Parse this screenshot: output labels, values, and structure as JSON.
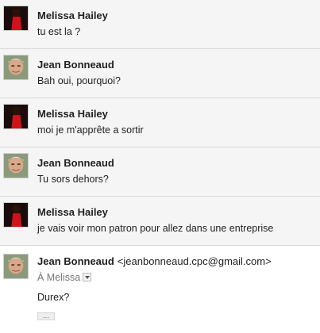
{
  "messages": [
    {
      "sender": "Melissa Hailey",
      "snippet": "tu est la ?",
      "avatar_icon": "woman-red-dress-avatar"
    },
    {
      "sender": "Jean Bonneaud",
      "snippet": "Bah oui, pourquoi?",
      "avatar_icon": "older-man-avatar"
    },
    {
      "sender": "Melissa Hailey",
      "snippet": "moi je m'apprête a sortir",
      "avatar_icon": "woman-red-dress-avatar"
    },
    {
      "sender": "Jean Bonneaud",
      "snippet": "Tu sors dehors?",
      "avatar_icon": "older-man-avatar"
    },
    {
      "sender": "Melissa Hailey",
      "snippet": "je vais voir mon patron pour allez dans une entreprise",
      "avatar_icon": "woman-red-dress-avatar"
    }
  ],
  "expanded_message": {
    "sender": "Jean Bonneaud",
    "email": "<jeanbonneaud.cpc@gmail.com>",
    "to_line": "À Melissa",
    "body": "Durex?",
    "show_trimmed_label": "…",
    "avatar_icon": "older-man-avatar"
  },
  "colors": {
    "collapsed_background": "#f5f5f5",
    "divider": "#d8d8d8",
    "text": "#222222",
    "secondary_text": "#777777"
  }
}
